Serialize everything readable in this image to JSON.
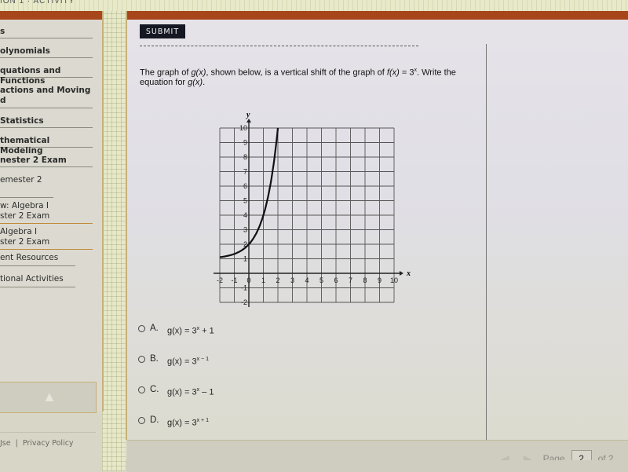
{
  "header": {
    "crumb": "ION 1 · ACTIVITY"
  },
  "sidebar": {
    "items": [
      {
        "label": "s"
      },
      {
        "label": "olynomials"
      },
      {
        "label": "quations and Functions"
      },
      {
        "label": "actions and Moving\nd"
      },
      {
        "label": "Statistics"
      },
      {
        "label": "thematical Modeling"
      },
      {
        "label": "nester 2 Exam"
      },
      {
        "label": "emester 2"
      },
      {
        "label": "w: Algebra I\nster 2 Exam"
      },
      {
        "label": " Algebra I\nster 2 Exam"
      },
      {
        "label": "ent Resources"
      },
      {
        "label": "tional Activities"
      }
    ],
    "up_icon": "arrow-up-icon"
  },
  "footer": {
    "terms": "Jse",
    "separator": "|",
    "privacy": "Privacy Policy"
  },
  "main": {
    "submit_label": "SUBMIT",
    "question": {
      "part1": "The graph of ",
      "g": "g(x)",
      "part2": ", shown below, is a vertical shift of the graph of ",
      "f": "f(x)",
      "part3": " = 3",
      "exp": "x",
      "part4": ". Write the equation for ",
      "g2": "g(x)",
      "part5": "."
    },
    "answers": [
      {
        "letter": "A.",
        "lhs": "g(x) = 3",
        "exp": "x",
        "tail": " + 1"
      },
      {
        "letter": "B.",
        "lhs": "g(x) = 3",
        "exp": "x − 1",
        "tail": ""
      },
      {
        "letter": "C.",
        "lhs": "g(x) = 3",
        "exp": "x",
        "tail": " – 1"
      },
      {
        "letter": "D.",
        "lhs": "g(x) = 3",
        "exp": "x + 1",
        "tail": ""
      }
    ],
    "pager": {
      "label": "Page",
      "current": "2",
      "of": "of 2"
    }
  },
  "chart_data": {
    "type": "line",
    "title": "",
    "xlabel": "x",
    "ylabel": "y",
    "xlim": [
      -2,
      10
    ],
    "ylim": [
      -2,
      10
    ],
    "x_ticks": [
      "-2",
      "-1",
      "0",
      "1",
      "2",
      "3",
      "4",
      "5",
      "6",
      "7",
      "8",
      "9",
      "10"
    ],
    "y_ticks": [
      "-2",
      "-1",
      "1",
      "2",
      "3",
      "4",
      "5",
      "6",
      "7",
      "8",
      "9",
      "10"
    ],
    "grid": true,
    "series": [
      {
        "name": "g(x)",
        "function": "3^x + 1",
        "x": [
          -2,
          -1.5,
          -1,
          -0.5,
          0,
          0.5,
          1,
          1.25,
          1.5,
          1.75,
          2
        ],
        "y": [
          1.11,
          1.19,
          1.33,
          1.58,
          2,
          2.73,
          4,
          4.95,
          6.2,
          7.84,
          10
        ]
      }
    ]
  }
}
